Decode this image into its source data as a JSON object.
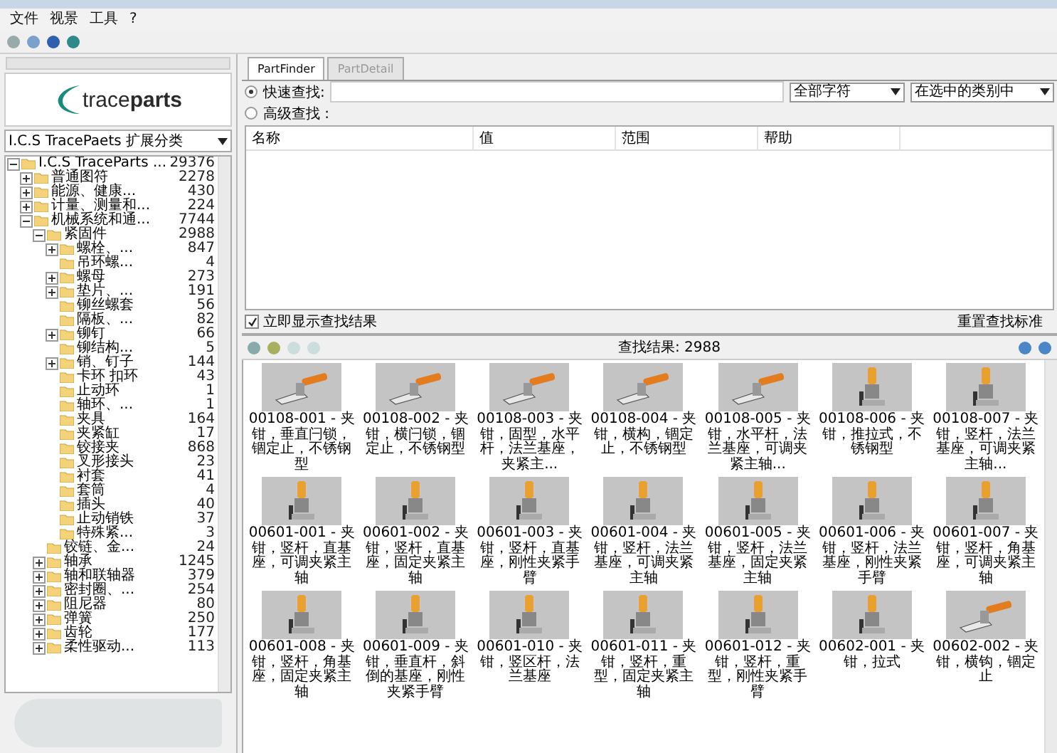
{
  "menu": [
    "文件",
    "视景",
    "工具",
    "?"
  ],
  "left_panel": {
    "logo": "trace**parts**",
    "classification": "I.C.S TracePaets 扩展分类",
    "tree": [
      {
        "label": "I.C.S TraceParts ...",
        "count": "29376",
        "expanded": true,
        "children": [
          {
            "label": "普通图符",
            "count": "2278",
            "expanded": false
          },
          {
            "label": "能源、健康...",
            "count": "430",
            "expanded": false
          },
          {
            "label": "计量、测量和...",
            "count": "224",
            "expanded": false
          },
          {
            "label": "机械系统和通...",
            "count": "7744",
            "expanded": true,
            "children": [
              {
                "label": "紧固件",
                "count": "2988",
                "expanded": true,
                "children": [
                  {
                    "label": "螺栓、...",
                    "count": "847",
                    "expanded": false
                  },
                  {
                    "label": "吊环螺...",
                    "count": "4"
                  },
                  {
                    "label": "螺母",
                    "count": "273",
                    "expanded": false
                  },
                  {
                    "label": "垫片、...",
                    "count": "191",
                    "expanded": false
                  },
                  {
                    "label": "铆丝螺套",
                    "count": "56"
                  },
                  {
                    "label": "隔板、...",
                    "count": "82"
                  },
                  {
                    "label": "铆钉",
                    "count": "66",
                    "expanded": false
                  },
                  {
                    "label": "铆结构...",
                    "count": "5"
                  },
                  {
                    "label": "销、钉子",
                    "count": "144",
                    "expanded": false
                  },
                  {
                    "label": "卡环 扣环",
                    "count": "43"
                  },
                  {
                    "label": "止动环",
                    "count": "1"
                  },
                  {
                    "label": "轴环、...",
                    "count": "1"
                  },
                  {
                    "label": "夹具",
                    "count": "164"
                  },
                  {
                    "label": "夹紧缸",
                    "count": "17"
                  },
                  {
                    "label": "铰接夹",
                    "count": "868"
                  },
                  {
                    "label": "叉形接头",
                    "count": "23"
                  },
                  {
                    "label": "衬套",
                    "count": "41"
                  },
                  {
                    "label": "套筒",
                    "count": "4"
                  },
                  {
                    "label": "插头",
                    "count": "40"
                  },
                  {
                    "label": "止动销铁",
                    "count": "37"
                  },
                  {
                    "label": "特殊紧...",
                    "count": "3"
                  }
                ]
              },
              {
                "label": "铰链、金...",
                "count": "24"
              },
              {
                "label": "轴承",
                "count": "1245",
                "expanded": false
              },
              {
                "label": "轴和联轴器",
                "count": "379",
                "expanded": false
              },
              {
                "label": "密封圈、...",
                "count": "254",
                "expanded": false
              },
              {
                "label": "阻尼器",
                "count": "80",
                "expanded": false
              },
              {
                "label": "弹簧",
                "count": "250",
                "expanded": false
              },
              {
                "label": "齿轮",
                "count": "177",
                "expanded": false
              },
              {
                "label": "柔性驱动...",
                "count": "113",
                "expanded": false
              }
            ]
          }
        ]
      }
    ]
  },
  "tabs": [
    {
      "label": "PartFinder",
      "selected": true
    },
    {
      "label": "PartDetail",
      "selected": false
    }
  ],
  "search_modes": [
    {
      "label": "快速查找:",
      "selected": true
    },
    {
      "label": "高级查找 :",
      "selected": false
    }
  ],
  "match_select": "全部字符",
  "scope_select": "在选中的类别中",
  "criteria_columns": [
    "名称",
    "值",
    "范围",
    "帮助"
  ],
  "show_results_immediately": {
    "label": "立即显示查找结果",
    "checked": true
  },
  "reset_button": "重置查找标准",
  "results_count": "查找结果: 2988",
  "results": [
    {
      "caption": "00108-001 - 夹钳，垂直闩锁，锢定止，不锈钢型",
      "kind": "horizontal"
    },
    {
      "caption": "00108-002 - 夹钳，横闩锁，锢定止，不锈钢型",
      "kind": "horizontal"
    },
    {
      "caption": "00108-003 - 夹钳，固型，水平杆，法兰基座，夹紧主...",
      "kind": "horizontal"
    },
    {
      "caption": "00108-004 - 夹钳，横构，锢定止，不锈钢型",
      "kind": "horizontal"
    },
    {
      "caption": "00108-005 - 夹钳，水平杆，法兰基座，可调夹紧主轴...",
      "kind": "horizontal"
    },
    {
      "caption": "00108-006 - 夹钳，推拉式，不锈钢型",
      "kind": "vertical"
    },
    {
      "caption": "00108-007 - 夹钳，竖杆，法兰基座，可调夹紧主轴...",
      "kind": "vertical"
    },
    {
      "caption": "00601-001 - 夹钳，竖杆，直基座，可调夹紧主轴",
      "kind": "vertical"
    },
    {
      "caption": "00601-002 - 夹钳，竖杆，直基座，固定夹紧主轴",
      "kind": "vertical"
    },
    {
      "caption": "00601-003 - 夹钳，竖杆，直基座，刚性夹紧手臂",
      "kind": "vertical"
    },
    {
      "caption": "00601-004 - 夹钳，竖杆，法兰基座，可调夹紧主轴",
      "kind": "vertical"
    },
    {
      "caption": "00601-005 - 夹钳，竖杆，法兰基座，固定夹紧主轴",
      "kind": "vertical"
    },
    {
      "caption": "00601-006 - 夹钳，竖杆，法兰基座，刚性夹紧手臂",
      "kind": "vertical"
    },
    {
      "caption": "00601-007 - 夹钳，竖杆，角基座，可调夹紧主轴",
      "kind": "vertical"
    },
    {
      "caption": "00601-008 - 夹钳，竖杆，角基座，固定夹紧主轴",
      "kind": "vertical"
    },
    {
      "caption": "00601-009 - 夹钳，垂直杆，斜倒的基座，刚性夹紧手臂",
      "kind": "vertical"
    },
    {
      "caption": "00601-010 - 夹钳，竖区杆，法兰基座",
      "kind": "vertical"
    },
    {
      "caption": "00601-011 - 夹钳，竖杆，重型，固定夹紧主轴",
      "kind": "vertical"
    },
    {
      "caption": "00601-012 - 夹钳，竖杆，重型，刚性夹紧手臂",
      "kind": "vertical"
    },
    {
      "caption": "00602-001 - 夹钳，拉式",
      "kind": "vertical"
    },
    {
      "caption": "00602-002 - 夹钳，横钩，锢定止",
      "kind": "horizontal"
    }
  ]
}
